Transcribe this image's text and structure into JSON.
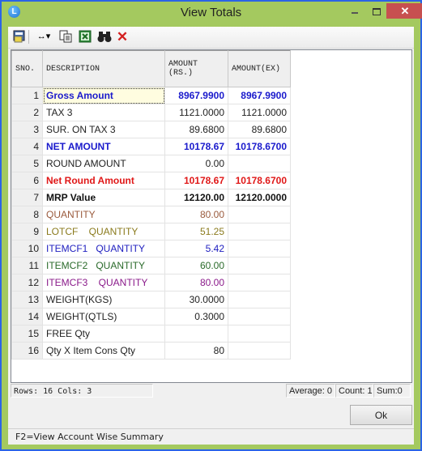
{
  "window": {
    "title": "View Totals",
    "app_icon_glyph": "L",
    "close_glyph": "✕"
  },
  "toolbar": {
    "items": [
      {
        "name": "save-layout-icon"
      },
      {
        "name": "column-width-icon",
        "glyph": "↔▾"
      },
      {
        "name": "copy-icon"
      },
      {
        "name": "excel-icon"
      },
      {
        "name": "find-icon"
      },
      {
        "name": "close-red-x-icon",
        "glyph": "✕"
      }
    ]
  },
  "grid": {
    "headers": [
      "SNO.",
      "DESCRIPTION",
      "AMOUNT (RS.)",
      "AMOUNT(EX)"
    ],
    "header_lines": {
      "amount": [
        "AMOUNT",
        "(RS.)"
      ]
    },
    "rows": [
      {
        "sno": "1",
        "desc": "Gross Amount",
        "amt": "8967.9900",
        "amtex": "8967.9900",
        "color": "#1a1acc",
        "bold": true,
        "selected": true
      },
      {
        "sno": "2",
        "desc": "TAX 3",
        "amt": "1121.0000",
        "amtex": "1121.0000",
        "color": "#222222",
        "bold": false
      },
      {
        "sno": "3",
        "desc": "SUR. ON TAX 3",
        "amt": "89.6800",
        "amtex": "89.6800",
        "color": "#222222",
        "bold": false
      },
      {
        "sno": "4",
        "desc": "NET AMOUNT",
        "amt": "10178.67",
        "amtex": "10178.6700",
        "color": "#1a1acc",
        "bold": true
      },
      {
        "sno": "5",
        "desc": "ROUND AMOUNT",
        "amt": "0.00",
        "amtex": "",
        "color": "#222222",
        "bold": false
      },
      {
        "sno": "6",
        "desc": "Net Round Amount",
        "amt": "10178.67",
        "amtex": "10178.6700",
        "color": "#e01818",
        "bold": true
      },
      {
        "sno": "7",
        "desc": "MRP Value",
        "amt": "12120.00",
        "amtex": "12120.0000",
        "color": "#111111",
        "bold": true
      },
      {
        "sno": "8",
        "desc": "QUANTITY",
        "amt": "80.00",
        "amtex": "",
        "color": "#9a5a3c",
        "bold": false
      },
      {
        "sno": "9",
        "desc": "LOTCF    QUANTITY",
        "amt": "51.25",
        "amtex": "",
        "color": "#8a7a1c",
        "bold": false
      },
      {
        "sno": "10",
        "desc": "ITEMCF1   QUANTITY",
        "amt": "5.42",
        "amtex": "",
        "color": "#2020c0",
        "bold": false
      },
      {
        "sno": "11",
        "desc": "ITEMCF2   QUANTITY",
        "amt": "60.00",
        "amtex": "",
        "color": "#2a6a2a",
        "bold": false
      },
      {
        "sno": "12",
        "desc": "ITEMCF3    QUANTITY",
        "amt": "80.00",
        "amtex": "",
        "color": "#8a1a8a",
        "bold": false
      },
      {
        "sno": "13",
        "desc": "WEIGHT(KGS)",
        "amt": "30.0000",
        "amtex": "",
        "color": "#222222",
        "bold": false
      },
      {
        "sno": "14",
        "desc": "WEIGHT(QTLS)",
        "amt": "0.3000",
        "amtex": "",
        "color": "#222222",
        "bold": false
      },
      {
        "sno": "15",
        "desc": "FREE Qty",
        "amt": "",
        "amtex": "",
        "color": "#222222",
        "bold": false
      },
      {
        "sno": "16",
        "desc": "Qty X Item Cons Qty",
        "amt": "80",
        "amtex": "",
        "color": "#222222",
        "bold": false
      }
    ]
  },
  "status": {
    "rows_cols": "Rows: 16  Cols: 3",
    "average": "Average: 0",
    "count": "Count: 1",
    "sum": "Sum:0"
  },
  "buttons": {
    "ok": "Ok"
  },
  "footer": {
    "hint": "F2=View Account Wise Summary"
  }
}
